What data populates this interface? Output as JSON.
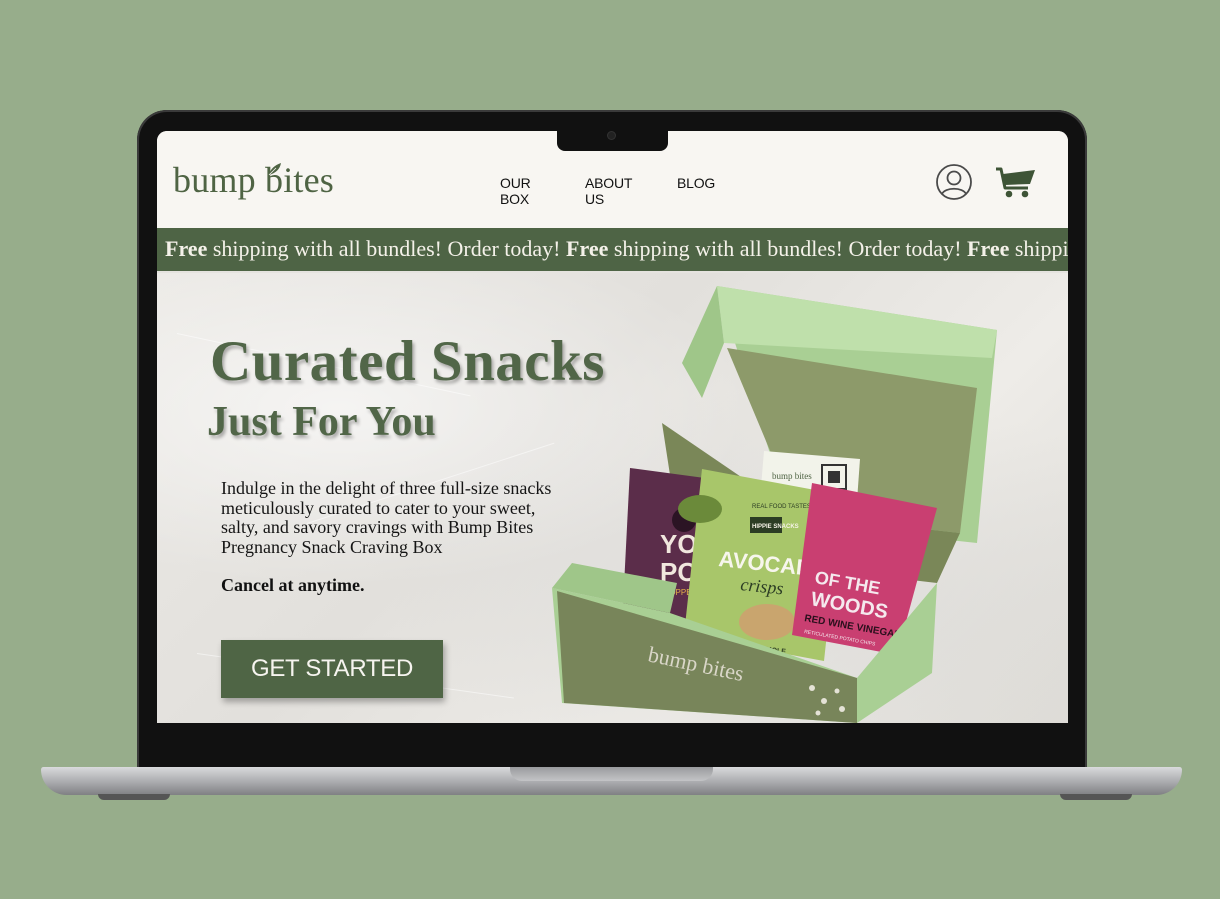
{
  "header": {
    "logo": "bump bites",
    "nav": [
      "OUR BOX",
      "ABOUT US",
      "BLOG"
    ]
  },
  "promo": {
    "segments": [
      {
        "bold": "Free",
        "rest": " shipping with all bundles! Order today! "
      },
      {
        "bold": "Free",
        "rest": " shipping with all bundles! Order today! "
      },
      {
        "bold": "Free",
        "rest": " shipping with all bundles! Order today!"
      }
    ]
  },
  "hero": {
    "title": "Curated Snacks",
    "subtitle": "Just For You",
    "description": "Indulge in the delight of three full-size snacks meticulously curated to cater to your sweet, salty, and savory cravings with Bump Bites Pregnancy Snack Craving Box",
    "cancel": "Cancel at anytime.",
    "cta": "GET STARTED"
  },
  "product": {
    "box_brand": "bump bites",
    "card_brand": "bump bites",
    "bags": [
      {
        "line1": "YOG",
        "line2": "POP",
        "small": "POPPED"
      },
      {
        "top": "REAL FOOD TASTES BETTER",
        "badge": "HIPPIE SNACKS",
        "line1": "AVOCADO",
        "line2": "crisps",
        "flavor": "GUACAMOLE"
      },
      {
        "line1": "OF THE",
        "line2": "WOODS",
        "line3": "RED WINE VINEGAR",
        "small": "RETICULATED POTATO CHIPS"
      }
    ]
  },
  "colors": {
    "background": "#97ad8b",
    "brand_green": "#4f6545",
    "header_bg": "#f8f6f2"
  },
  "icons": [
    "leaf-icon",
    "account-icon",
    "cart-icon"
  ]
}
